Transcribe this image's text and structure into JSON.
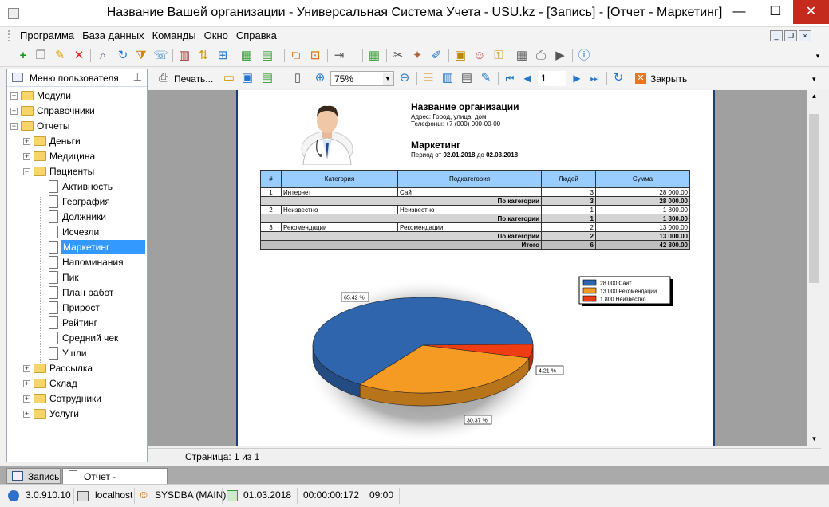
{
  "window": {
    "title": "Название Вашей организации - Универсальная Система Учета - USU.kz - [Запись] - [Отчет - Маркетинг]",
    "minimize": "—",
    "maximize": "☐",
    "close": "✕"
  },
  "menu": [
    "Программа",
    "База данных",
    "Команды",
    "Окно",
    "Справка"
  ],
  "left_panel": {
    "title": "Меню пользователя",
    "tree": [
      {
        "label": "Модули",
        "level": 0,
        "type": "folder",
        "expander": "+"
      },
      {
        "label": "Справочники",
        "level": 0,
        "type": "folder",
        "expander": "+"
      },
      {
        "label": "Отчеты",
        "level": 0,
        "type": "folder",
        "expander": "−"
      },
      {
        "label": "Деньги",
        "level": 1,
        "type": "folder",
        "expander": "+"
      },
      {
        "label": "Медицина",
        "level": 1,
        "type": "folder",
        "expander": "+"
      },
      {
        "label": "Пациенты",
        "level": 1,
        "type": "folder",
        "expander": "−"
      },
      {
        "label": "Активность",
        "level": 2,
        "type": "doc"
      },
      {
        "label": "География",
        "level": 2,
        "type": "doc"
      },
      {
        "label": "Должники",
        "level": 2,
        "type": "doc"
      },
      {
        "label": "Исчезли",
        "level": 2,
        "type": "doc"
      },
      {
        "label": "Маркетинг",
        "level": 2,
        "type": "doc",
        "selected": true
      },
      {
        "label": "Напоминания",
        "level": 2,
        "type": "doc"
      },
      {
        "label": "Пик",
        "level": 2,
        "type": "doc"
      },
      {
        "label": "План работ",
        "level": 2,
        "type": "doc"
      },
      {
        "label": "Прирост",
        "level": 2,
        "type": "doc"
      },
      {
        "label": "Рейтинг",
        "level": 2,
        "type": "doc"
      },
      {
        "label": "Средний чек",
        "level": 2,
        "type": "doc"
      },
      {
        "label": "Ушли",
        "level": 2,
        "type": "doc"
      },
      {
        "label": "Рассылка",
        "level": 1,
        "type": "folder",
        "expander": "+"
      },
      {
        "label": "Склад",
        "level": 1,
        "type": "folder",
        "expander": "+"
      },
      {
        "label": "Сотрудники",
        "level": 1,
        "type": "folder",
        "expander": "+"
      },
      {
        "label": "Услуги",
        "level": 1,
        "type": "folder",
        "expander": "+"
      }
    ]
  },
  "report_toolbar": {
    "print_label": "Печать...",
    "zoom": "75%",
    "page_number": "1",
    "close_label": "Закрыть"
  },
  "report": {
    "org_name": "Название организации",
    "address": "Адрес: Город, улица, дом",
    "phone": "Телефоны: +7 (000) 000-00-00",
    "title": "Маркетинг",
    "period_prefix": "Период от ",
    "period_from": "02.01.2018",
    "period_mid": " до ",
    "period_to": "02.03.2018",
    "table": {
      "headers": [
        "#",
        "Категория",
        "Подкатегория",
        "Людей",
        "Сумма"
      ],
      "rows": [
        {
          "kind": "data",
          "cells": [
            "1",
            "Интернет",
            "Сайт",
            "3",
            "28 000.00"
          ]
        },
        {
          "kind": "sub",
          "label": "По категории",
          "people": "3",
          "sum": "28 000.00"
        },
        {
          "kind": "data",
          "cells": [
            "2",
            "Неизвестно",
            "Неизвестно",
            "1",
            "1 800.00"
          ]
        },
        {
          "kind": "sub",
          "label": "По категории",
          "people": "1",
          "sum": "1 800.00"
        },
        {
          "kind": "data",
          "cells": [
            "3",
            "Рекомендации",
            "Рекомендации",
            "2",
            "13 000.00"
          ]
        },
        {
          "kind": "sub",
          "label": "По категории",
          "people": "2",
          "sum": "13 000.00"
        },
        {
          "kind": "total",
          "label": "Итого",
          "people": "6",
          "sum": "42 800.00"
        }
      ]
    }
  },
  "chart_data": {
    "type": "pie",
    "legend_position": "top-right",
    "slices": [
      {
        "label": "28 000 Сайт",
        "value": 28000,
        "percent_label": "65.42 %",
        "color": "#2e65ad"
      },
      {
        "label": "13 000 Рекомендации",
        "value": 13000,
        "percent_label": "30.37 %",
        "color": "#f59a23"
      },
      {
        "label": "1 800 Неизвестно",
        "value": 1800,
        "percent_label": "4.21 %",
        "color": "#f03c12"
      }
    ]
  },
  "status_line": {
    "page_info": "Страница: 1 из 1"
  },
  "tabs": [
    {
      "label": "Запись",
      "active": false
    },
    {
      "label": "Отчет - Маркетинг",
      "active": true
    }
  ],
  "status_bar": {
    "version": "3.0.910.10",
    "server": "localhost",
    "user": "SYSDBA (MAIN)",
    "date": "01.03.2018",
    "timer": "00:00:00:172",
    "time": "09:00"
  }
}
